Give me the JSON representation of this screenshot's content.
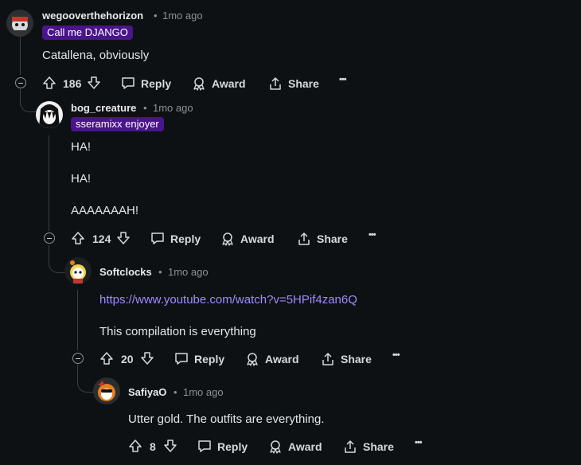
{
  "comments": [
    {
      "username": "wegooverthehorizon",
      "time": "1mo ago",
      "flair": "Call me DJANGO",
      "body": [
        "Catallena, obviously"
      ],
      "votes": "186"
    },
    {
      "username": "bog_creature",
      "time": "1mo ago",
      "flair": "sseramixx enjoyer",
      "body": [
        "HA!",
        "HA!",
        "AAAAAAAH!"
      ],
      "votes": "124"
    },
    {
      "username": "Softclocks",
      "time": "1mo ago",
      "body_link": "https://www.youtube.com/watch?v=5HPif4zan6Q",
      "body": [
        "This compilation is everything"
      ],
      "votes": "20"
    },
    {
      "username": "SafiyaO",
      "time": "1mo ago",
      "body": [
        "Utter gold. The outfits are everything."
      ],
      "votes": "8"
    }
  ],
  "actions": {
    "reply": "Reply",
    "award": "Award",
    "share": "Share",
    "more": "•••",
    "separator": "•"
  },
  "icons": [
    "upvote-icon",
    "downvote-icon",
    "reply-icon",
    "award-icon",
    "share-icon",
    "collapse-icon",
    "more-icon"
  ],
  "colors": {
    "background": "#0e1113",
    "flair": "#4a148c",
    "link": "#9c8cff",
    "thread": "#3a3f42"
  }
}
